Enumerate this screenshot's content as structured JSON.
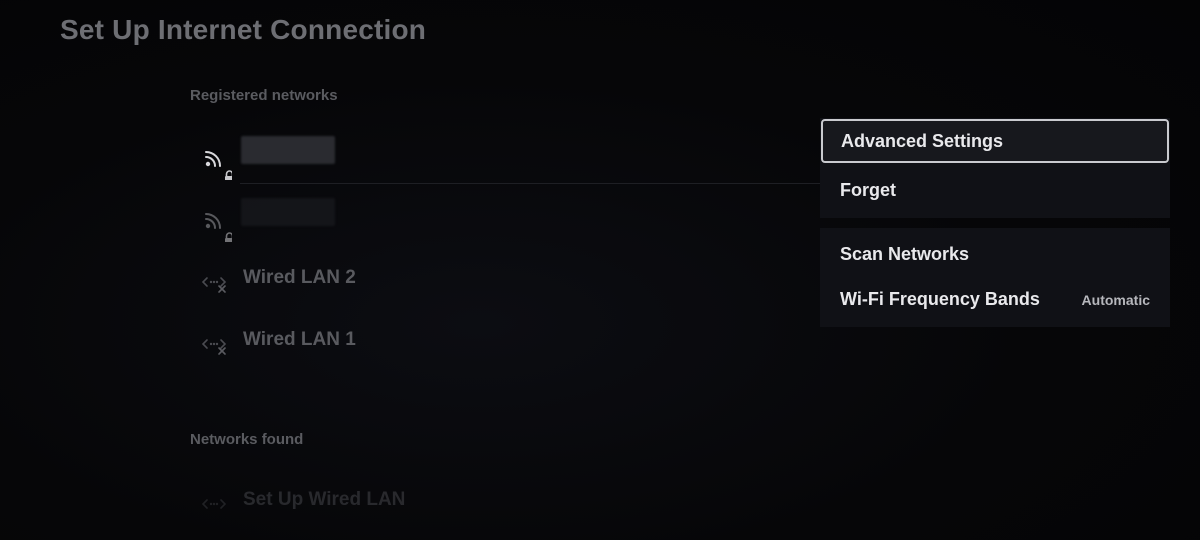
{
  "page": {
    "title": "Set Up Internet Connection"
  },
  "registered": {
    "heading": "Registered networks",
    "items": [
      {
        "type": "wifi",
        "label": "",
        "locked": true,
        "icon": "wifi-signal-icon"
      },
      {
        "type": "wifi",
        "label": "",
        "locked": true,
        "icon": "wifi-signal-icon"
      },
      {
        "type": "wired",
        "label": "Wired LAN 2",
        "icon": "wired-lan-disconnected-icon"
      },
      {
        "type": "wired",
        "label": "Wired LAN 1",
        "icon": "wired-lan-disconnected-icon"
      }
    ]
  },
  "found": {
    "heading": "Networks found",
    "items": [
      {
        "type": "wired",
        "label": "Set Up Wired LAN",
        "icon": "wired-lan-icon"
      }
    ]
  },
  "options_menu": {
    "group1": [
      {
        "label": "Advanced Settings",
        "focused": true
      },
      {
        "label": "Forget",
        "focused": false
      }
    ],
    "group2": [
      {
        "label": "Scan Networks",
        "value": ""
      },
      {
        "label": "Wi-Fi Frequency Bands",
        "value": "Automatic"
      }
    ]
  },
  "colors": {
    "background": "#050507",
    "menu_background": "#101116",
    "focus_border": "#c9cacf",
    "dim_text": "#595a5f"
  }
}
